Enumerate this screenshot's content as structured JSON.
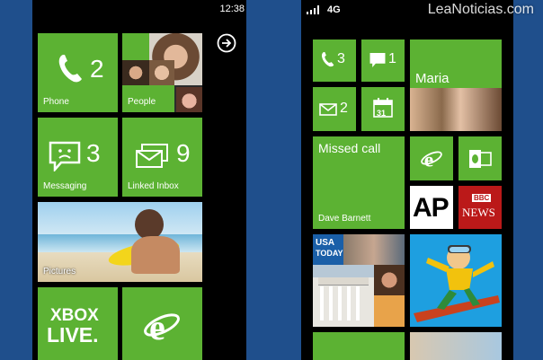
{
  "left": {
    "status_time": "12:38",
    "tiles": {
      "phone": {
        "label": "Phone",
        "count": "2"
      },
      "people": {
        "label": "People"
      },
      "messaging": {
        "label": "Messaging",
        "count": "3"
      },
      "linked_inbox": {
        "label": "Linked Inbox",
        "count": "9"
      },
      "pictures": {
        "label": "Pictures"
      },
      "xbox": {
        "line1": "XBOX",
        "line2": "LIVE."
      }
    },
    "arrow_icon": "arrow-right-circle-icon"
  },
  "right": {
    "status_network": "4G",
    "tiles": {
      "phone_count": "3",
      "messaging_count": "1",
      "mail_count": "2",
      "calendar_day": "31",
      "maria": {
        "label": "Maria"
      },
      "missed_call": {
        "title": "Missed call",
        "caller": "Dave Barnett"
      },
      "ap": {
        "text": "AP"
      },
      "bbc": {
        "line1": "BBC",
        "line2": "NEWS"
      },
      "usa_today": {
        "line1": "USA",
        "line2": "TODAY"
      }
    }
  },
  "watermark": "LeaNoticias.com",
  "colors": {
    "tile_green": "#5cb233",
    "background_blue": "#1f4f8c",
    "bbc_red": "#bb1919"
  }
}
